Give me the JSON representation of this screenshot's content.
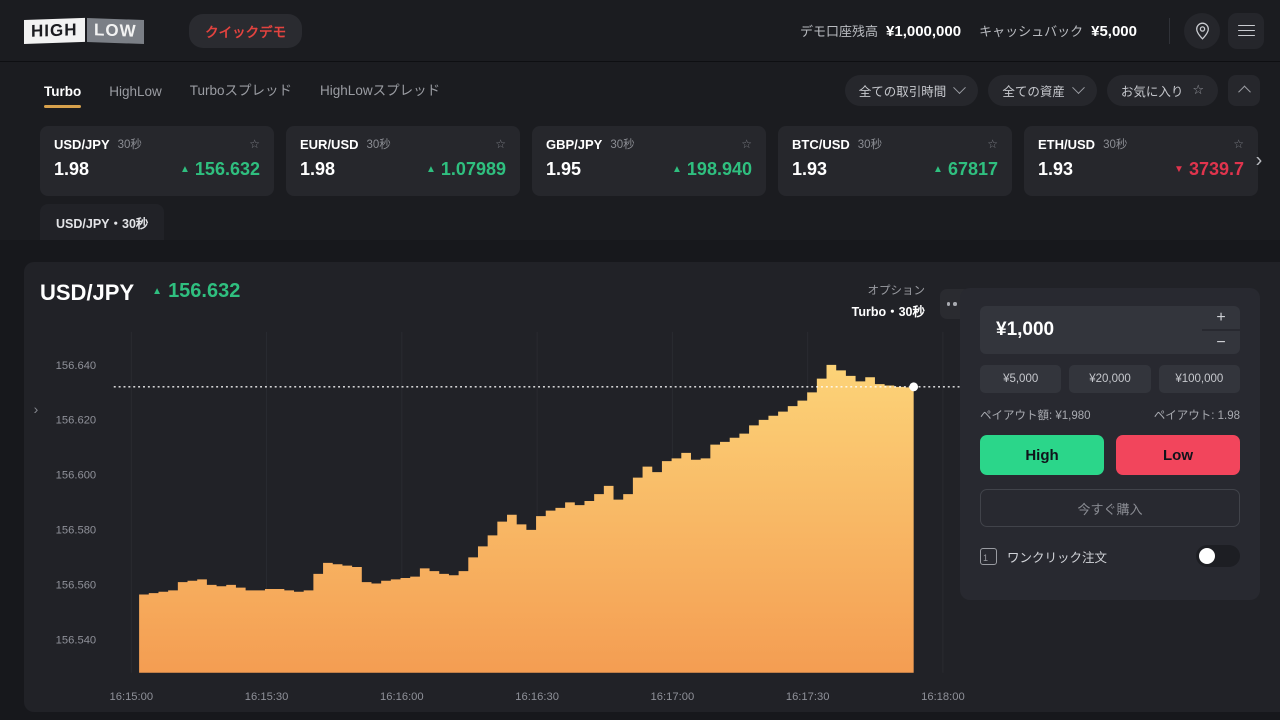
{
  "header": {
    "logo_high": "HIGH",
    "logo_low": "LOW",
    "quick_demo": "クイックデモ",
    "balance_label": "デモ口座残高",
    "balance_value": "¥1,000,000",
    "cashback_label": "キャッシュバック",
    "cashback_value": "¥5,000",
    "pin_icon": "location-pin-icon",
    "menu_icon": "hamburger-menu-icon"
  },
  "tabs": [
    {
      "label": "Turbo",
      "active": true
    },
    {
      "label": "HighLow",
      "active": false
    },
    {
      "label": "Turboスプレッド",
      "active": false
    },
    {
      "label": "HighLowスプレッド",
      "active": false
    }
  ],
  "filters": {
    "duration": "全ての取引時間",
    "asset": "全ての資産",
    "favorite": "お気に入り",
    "collapse_icon": "chevron-up-icon"
  },
  "assets": [
    {
      "symbol": "USD/JPY",
      "duration": "30秒",
      "payout": "1.98",
      "price": "156.632",
      "direction": "up"
    },
    {
      "symbol": "EUR/USD",
      "duration": "30秒",
      "payout": "1.98",
      "price": "1.07989",
      "direction": "up"
    },
    {
      "symbol": "GBP/JPY",
      "duration": "30秒",
      "payout": "1.95",
      "price": "198.940",
      "direction": "up"
    },
    {
      "symbol": "BTC/USD",
      "duration": "30秒",
      "payout": "1.93",
      "price": "67817",
      "direction": "up"
    },
    {
      "symbol": "ETH/USD",
      "duration": "30秒",
      "payout": "1.93",
      "price": "3739.7",
      "direction": "down"
    }
  ],
  "strip_next_icon": "chevron-right-icon",
  "chart_tab": "USD/JPY・30秒",
  "chart_header": {
    "symbol": "USD/JPY",
    "price": "156.632",
    "direction": "up",
    "option_label": "オプション",
    "option_value": "Turbo・30秒",
    "more_icon": "more-options-icon",
    "expand_icon": "chevron-right-icon"
  },
  "trade": {
    "amount": "¥1,000",
    "plus": "+",
    "minus": "−",
    "chips": [
      "¥5,000",
      "¥20,000",
      "¥100,000"
    ],
    "payout_amount_label": "ペイアウト額: ¥1,980",
    "payout_rate_label": "ペイアウト: 1.98",
    "high_label": "High",
    "low_label": "Low",
    "buy_now_label": "今すぐ購入",
    "oneclick_label": "ワンクリック注文",
    "oneclick_on": false,
    "oneclick_icon": "one-click-icon"
  },
  "colors": {
    "up": "#2fbf7f",
    "down": "#e0344d",
    "accent": "#d7a14c",
    "high": "#2bd68a",
    "low": "#f2455c",
    "chart_line_top": "#fcd378",
    "chart_line_bottom": "#f2994a"
  },
  "chart_data": {
    "type": "area",
    "title": "USD/JPY",
    "xlabel": "",
    "ylabel": "",
    "ylim": [
      156.528,
      156.652
    ],
    "yticks": [
      "156.640",
      "156.620",
      "156.600",
      "156.580",
      "156.560",
      "156.540"
    ],
    "ytick_values": [
      156.64,
      156.62,
      156.6,
      156.58,
      156.56,
      156.54
    ],
    "xticks": [
      "16:15:00",
      "16:15:30",
      "16:16:00",
      "16:16:30",
      "16:17:00",
      "16:17:30",
      "16:18:00"
    ],
    "grid": true,
    "current_price": 156.632,
    "current_price_line": true,
    "series_name": "USD/JPY",
    "values": [
      156.5565,
      156.557,
      156.5575,
      156.558,
      156.561,
      156.5615,
      156.562,
      156.56,
      156.5595,
      156.56,
      156.559,
      156.558,
      156.558,
      156.5585,
      156.5585,
      156.558,
      156.5575,
      156.558,
      156.564,
      156.568,
      156.5675,
      156.567,
      156.5665,
      156.561,
      156.5605,
      156.5615,
      156.562,
      156.5625,
      156.563,
      156.566,
      156.565,
      156.564,
      156.5635,
      156.565,
      156.57,
      156.574,
      156.578,
      156.583,
      156.5855,
      156.582,
      156.58,
      156.585,
      156.587,
      156.588,
      156.59,
      156.589,
      156.5905,
      156.593,
      156.596,
      156.591,
      156.593,
      156.599,
      156.603,
      156.601,
      156.605,
      156.606,
      156.608,
      156.6055,
      156.606,
      156.611,
      156.612,
      156.6135,
      156.615,
      156.618,
      156.62,
      156.6215,
      156.623,
      156.625,
      156.627,
      156.63,
      156.635,
      156.64,
      156.638,
      156.636,
      156.634,
      156.6355,
      156.633,
      156.6325,
      156.632,
      156.6318,
      156.632
    ]
  }
}
